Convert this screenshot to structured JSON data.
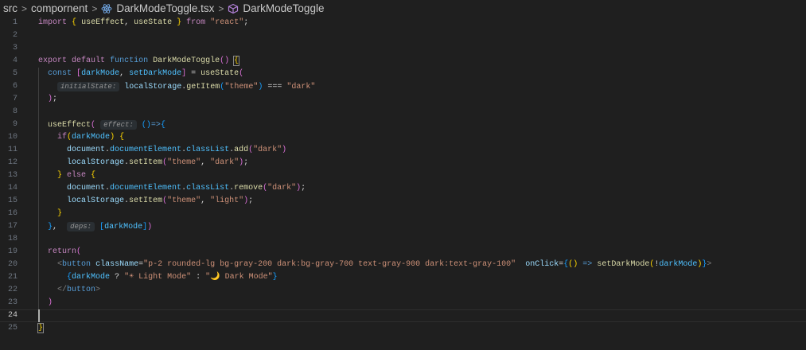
{
  "breadcrumb": {
    "items": [
      "src",
      "compornent",
      "DarkModeToggle.tsx",
      "DarkModeToggle"
    ],
    "icons": [
      "react-icon",
      "cube-icon"
    ]
  },
  "editor": {
    "current_line": 24,
    "lines": [
      [
        [
          "import",
          "k"
        ],
        [
          " ",
          "p"
        ],
        [
          "{",
          "b1"
        ],
        [
          " ",
          "p"
        ],
        [
          "useEffect",
          "f"
        ],
        [
          ", ",
          "p"
        ],
        [
          "useState",
          "f"
        ],
        [
          " ",
          "p"
        ],
        [
          "}",
          "b1"
        ],
        [
          " ",
          "p"
        ],
        [
          "from",
          "k"
        ],
        [
          " ",
          "p"
        ],
        [
          "\"react\"",
          "str"
        ],
        [
          ";",
          "p"
        ]
      ],
      [],
      [],
      [
        [
          "export",
          "k"
        ],
        [
          " ",
          "p"
        ],
        [
          "default",
          "k"
        ],
        [
          " ",
          "p"
        ],
        [
          "function",
          "s"
        ],
        [
          " ",
          "p"
        ],
        [
          "DarkModeToggle",
          "f"
        ],
        [
          "(",
          "b2"
        ],
        [
          ")",
          "b2"
        ],
        [
          " ",
          "p"
        ],
        [
          "{",
          "b1box"
        ]
      ],
      [
        [
          "  ",
          "p"
        ],
        [
          "const",
          "s"
        ],
        [
          " ",
          "p"
        ],
        [
          "[",
          "b2"
        ],
        [
          "darkMode",
          "c"
        ],
        [
          ", ",
          "p"
        ],
        [
          "setDarkMode",
          "c"
        ],
        [
          "]",
          "b2"
        ],
        [
          " = ",
          "p"
        ],
        [
          "useState",
          "f"
        ],
        [
          "(",
          "b2"
        ]
      ],
      [
        [
          "    ",
          "p"
        ],
        [
          "initialState:",
          "h"
        ],
        [
          " ",
          "p"
        ],
        [
          "localStorage",
          "v"
        ],
        [
          ".",
          "p"
        ],
        [
          "getItem",
          "f"
        ],
        [
          "(",
          "b3"
        ],
        [
          "\"theme\"",
          "str"
        ],
        [
          ")",
          "b3"
        ],
        [
          " === ",
          "p"
        ],
        [
          "\"dark\"",
          "str"
        ]
      ],
      [
        [
          "  ",
          "p"
        ],
        [
          ")",
          "b2"
        ],
        [
          ";",
          "p"
        ]
      ],
      [],
      [
        [
          "  ",
          "p"
        ],
        [
          "useEffect",
          "f"
        ],
        [
          "(",
          "b2"
        ],
        [
          " ",
          "p"
        ],
        [
          "effect:",
          "h"
        ],
        [
          " ",
          "p"
        ],
        [
          "(",
          "b3"
        ],
        [
          ")",
          "b3"
        ],
        [
          "=>",
          "s"
        ],
        [
          "{",
          "b3"
        ]
      ],
      [
        [
          "    ",
          "p"
        ],
        [
          "if",
          "k"
        ],
        [
          "(",
          "b1"
        ],
        [
          "darkMode",
          "c"
        ],
        [
          ")",
          "b1"
        ],
        [
          " ",
          "p"
        ],
        [
          "{",
          "b1"
        ]
      ],
      [
        [
          "      ",
          "p"
        ],
        [
          "document",
          "v"
        ],
        [
          ".",
          "p"
        ],
        [
          "documentElement",
          "c"
        ],
        [
          ".",
          "p"
        ],
        [
          "classList",
          "c"
        ],
        [
          ".",
          "p"
        ],
        [
          "add",
          "f"
        ],
        [
          "(",
          "b2"
        ],
        [
          "\"dark\"",
          "str"
        ],
        [
          ")",
          "b2"
        ]
      ],
      [
        [
          "      ",
          "p"
        ],
        [
          "localStorage",
          "v"
        ],
        [
          ".",
          "p"
        ],
        [
          "setItem",
          "f"
        ],
        [
          "(",
          "b2"
        ],
        [
          "\"theme\"",
          "str"
        ],
        [
          ", ",
          "p"
        ],
        [
          "\"dark\"",
          "str"
        ],
        [
          ")",
          "b2"
        ],
        [
          ";",
          "p"
        ]
      ],
      [
        [
          "    ",
          "p"
        ],
        [
          "}",
          "b1"
        ],
        [
          " ",
          "p"
        ],
        [
          "else",
          "k"
        ],
        [
          " ",
          "p"
        ],
        [
          "{",
          "b1"
        ]
      ],
      [
        [
          "      ",
          "p"
        ],
        [
          "document",
          "v"
        ],
        [
          ".",
          "p"
        ],
        [
          "documentElement",
          "c"
        ],
        [
          ".",
          "p"
        ],
        [
          "classList",
          "c"
        ],
        [
          ".",
          "p"
        ],
        [
          "remove",
          "f"
        ],
        [
          "(",
          "b2"
        ],
        [
          "\"dark\"",
          "str"
        ],
        [
          ")",
          "b2"
        ],
        [
          ";",
          "p"
        ]
      ],
      [
        [
          "      ",
          "p"
        ],
        [
          "localStorage",
          "v"
        ],
        [
          ".",
          "p"
        ],
        [
          "setItem",
          "f"
        ],
        [
          "(",
          "b2"
        ],
        [
          "\"theme\"",
          "str"
        ],
        [
          ", ",
          "p"
        ],
        [
          "\"light\"",
          "str"
        ],
        [
          ")",
          "b2"
        ],
        [
          ";",
          "p"
        ]
      ],
      [
        [
          "    ",
          "p"
        ],
        [
          "}",
          "b1"
        ]
      ],
      [
        [
          "  ",
          "p"
        ],
        [
          "}",
          "b3"
        ],
        [
          ",",
          "p"
        ],
        [
          "  ",
          "p"
        ],
        [
          "deps:",
          "h"
        ],
        [
          " ",
          "p"
        ],
        [
          "[",
          "b3"
        ],
        [
          "darkMode",
          "c"
        ],
        [
          "]",
          "b3"
        ],
        [
          ")",
          "b2"
        ]
      ],
      [],
      [
        [
          "  ",
          "p"
        ],
        [
          "return",
          "k"
        ],
        [
          "(",
          "b2"
        ]
      ],
      [
        [
          "    ",
          "p"
        ],
        [
          "<",
          "a"
        ],
        [
          "button",
          "t"
        ],
        [
          " ",
          "p"
        ],
        [
          "className",
          "at"
        ],
        [
          "=",
          "p"
        ],
        [
          "\"p-2 rounded-lg bg-gray-200 dark:bg-gray-700 text-gray-900 dark:text-gray-100\"",
          "str"
        ],
        [
          "  ",
          "p"
        ],
        [
          "onClick",
          "at"
        ],
        [
          "=",
          "p"
        ],
        [
          "{",
          "b3"
        ],
        [
          "(",
          "b1"
        ],
        [
          ")",
          "b1"
        ],
        [
          " ",
          "p"
        ],
        [
          "=>",
          "s"
        ],
        [
          " ",
          "p"
        ],
        [
          "setDarkMode",
          "f"
        ],
        [
          "(",
          "b1"
        ],
        [
          "!",
          "p"
        ],
        [
          "darkMode",
          "c"
        ],
        [
          ")",
          "b1"
        ],
        [
          "}",
          "b3"
        ],
        [
          ">",
          "a"
        ]
      ],
      [
        [
          "      ",
          "p"
        ],
        [
          "{",
          "b3"
        ],
        [
          "darkMode",
          "c"
        ],
        [
          " ? ",
          "p"
        ],
        [
          "\"☀ Light Mode\"",
          "str"
        ],
        [
          " : ",
          "p"
        ],
        [
          "\"🌙 Dark Mode\"",
          "str"
        ],
        [
          "}",
          "b3"
        ]
      ],
      [
        [
          "    ",
          "p"
        ],
        [
          "</",
          "a"
        ],
        [
          "button",
          "t"
        ],
        [
          ">",
          "a"
        ]
      ],
      [
        [
          "  ",
          "p"
        ],
        [
          ")",
          "b2"
        ]
      ],
      [],
      [
        [
          "}",
          "b1box"
        ]
      ]
    ]
  }
}
